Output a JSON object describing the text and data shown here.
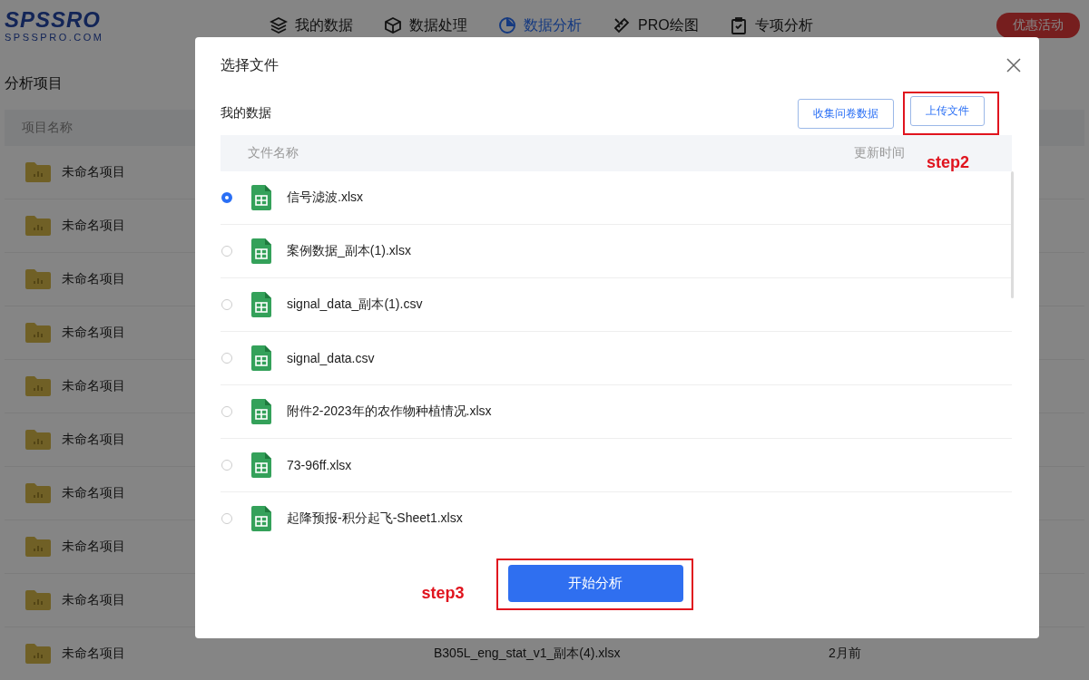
{
  "header": {
    "logo": "SPSSRO",
    "logo_sub": "SPSSPRO.COM",
    "nav": [
      {
        "label": "我的数据",
        "selected": false
      },
      {
        "label": "数据处理",
        "selected": false
      },
      {
        "label": "数据分析",
        "selected": true
      },
      {
        "label": "PRO绘图",
        "selected": false
      },
      {
        "label": "专项分析",
        "selected": false
      }
    ],
    "promo_button": "优惠活动"
  },
  "projects": {
    "title": "分析项目",
    "column": "项目名称",
    "rows": [
      {
        "name": "未命名项目"
      },
      {
        "name": "未命名项目"
      },
      {
        "name": "未命名项目"
      },
      {
        "name": "未命名项目"
      },
      {
        "name": "未命名项目"
      },
      {
        "name": "未命名项目"
      },
      {
        "name": "未命名项目"
      },
      {
        "name": "未命名项目"
      },
      {
        "name": "未命名项目"
      },
      {
        "name": "未命名项目",
        "file": "B305L_eng_stat_v1_副本(4).xlsx",
        "updated": "2月前"
      }
    ]
  },
  "dialog": {
    "title": "选择文件",
    "section": "我的数据",
    "buttons": [
      {
        "label": "收集问卷数据",
        "highlighted": false
      },
      {
        "label": "上传文件",
        "highlighted": true,
        "step": "step2"
      }
    ],
    "columns": [
      "文件名称",
      "更新时间"
    ],
    "files": [
      {
        "name": "信号滤波.xlsx",
        "selected": true
      },
      {
        "name": "案例数据_副本(1).xlsx",
        "selected": false
      },
      {
        "name": "signal_data_副本(1).csv",
        "selected": false
      },
      {
        "name": "signal_data.csv",
        "selected": false
      },
      {
        "name": "附件2-2023年的农作物种植情况.xlsx",
        "selected": false
      },
      {
        "name": "73-96ff.xlsx",
        "selected": false
      },
      {
        "name": "起降预报-积分起飞-Sheet1.xlsx",
        "selected": false
      }
    ],
    "start_button": {
      "label": "开始分析",
      "highlighted": true,
      "step": "step3"
    }
  }
}
